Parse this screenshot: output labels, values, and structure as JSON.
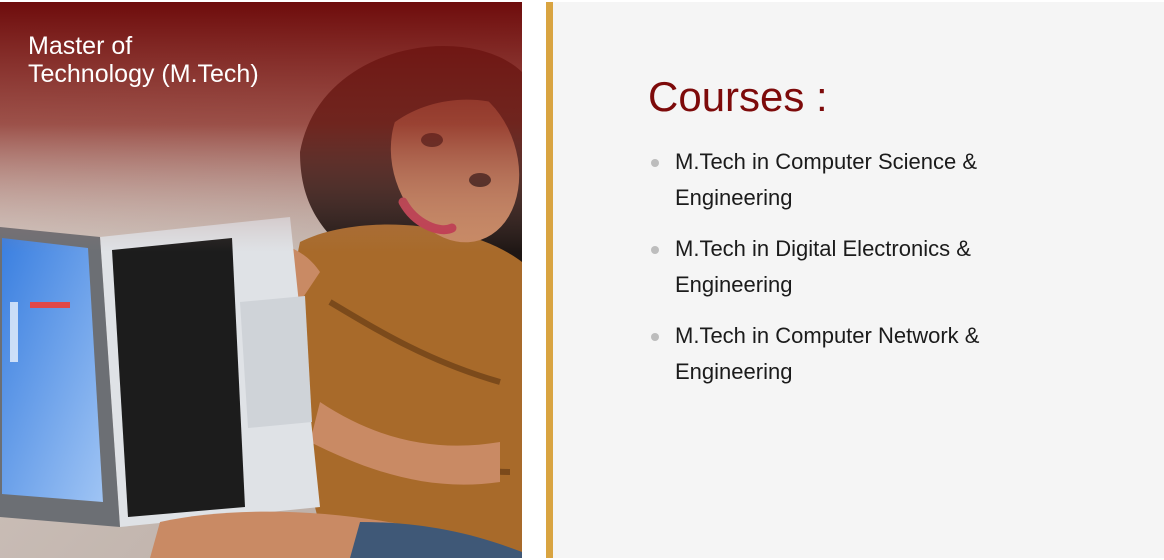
{
  "hero": {
    "title_line1": "Master of",
    "title_line2": "Technology (M.Tech)",
    "image_alt": "student-with-laptop-photo"
  },
  "colors": {
    "heading": "#7d0a0a",
    "accent_bar": "#d9a441",
    "panel_bg": "#f5f5f5",
    "bullet": "#bdbdbd"
  },
  "courses": {
    "heading": "Courses :",
    "items": [
      "M.Tech in Computer Science & Engineering",
      "M.Tech in Digital Electronics & Engineering",
      "M.Tech in Computer Network & Engineering"
    ]
  }
}
